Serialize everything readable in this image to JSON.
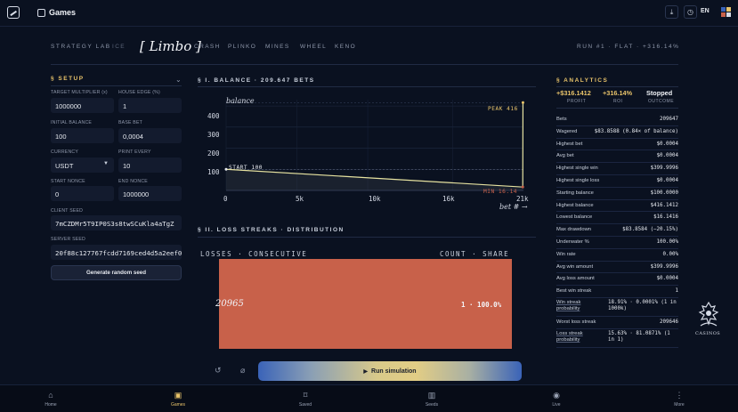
{
  "app": {
    "title": "Games",
    "language": "EN"
  },
  "strategy": {
    "label": "STRATEGY LAB",
    "tabs": [
      "ICE",
      "CRASH",
      "PLINKO",
      "MINES",
      "WHEEL",
      "KENO"
    ],
    "active_game": "[ Limbo ]",
    "run_info": "RUN #1 · FLAT · +316.14%"
  },
  "setup": {
    "title": "§ SETUP",
    "target_multiplier": {
      "label": "TARGET MULTIPLIER (x)",
      "value": "1000000"
    },
    "house_edge": {
      "label": "HOUSE EDGE (%)",
      "value": "1"
    },
    "initial_balance": {
      "label": "INITIAL BALANCE",
      "value": "100"
    },
    "base_bet": {
      "label": "BASE BET",
      "value": "0,0004"
    },
    "currency": {
      "label": "CURRENCY",
      "value": "USDT"
    },
    "print_every": {
      "label": "PRINT EVERY",
      "value": "10"
    },
    "start_nonce": {
      "label": "START NONCE",
      "value": "0"
    },
    "end_nonce": {
      "label": "END NONCE",
      "value": "1000000"
    },
    "client_seed": {
      "label": "CLIENT SEED",
      "value": "7mCZDMr5T9IP0S3s8twSCuKla4aTgZ"
    },
    "server_seed": {
      "label": "SERVER SEED",
      "value": "20f88c127767fcdd7169ced4d5a2eef0b"
    },
    "generate_label": "Generate random seed"
  },
  "balance_chart": {
    "section_title": "§ I. BALANCE · 209.647 BETS",
    "annotations": {
      "start": "START 100",
      "peak": "PEAK 416",
      "min": "MIN 16.14"
    }
  },
  "chart_data": {
    "type": "line",
    "title": "",
    "xlabel": "bet # →",
    "ylabel": "balance",
    "x_ticks": [
      "0",
      "5k",
      "10k",
      "16k",
      "21k"
    ],
    "y_ticks": [
      "100",
      "200",
      "300",
      "400"
    ],
    "xlim": [
      0,
      21000
    ],
    "ylim": [
      0,
      430
    ],
    "grid": true,
    "series": [
      {
        "x": [
          0,
          20950,
          20965
        ],
        "y": [
          100,
          16.14,
          416.14
        ]
      }
    ]
  },
  "distribution": {
    "section_title": "§ II. LOSS STREAKS · DISTRIBUTION",
    "col_left": "LOSSES · CONSECUTIVE",
    "col_right": "COUNT · SHARE",
    "rows": [
      {
        "key": "20965",
        "value": "1 · 100.0%",
        "share": 1.0
      }
    ]
  },
  "controls": {
    "run_label": "Run simulation",
    "reset_icon": "↺",
    "link_icon": "⌀"
  },
  "analytics": {
    "title": "§ ANALYTICS",
    "kpis": [
      {
        "value": "+$316.1412",
        "label": "PROFIT",
        "color": "#e8c36a"
      },
      {
        "value": "+316.14%",
        "label": "ROI",
        "color": "#e8c36a"
      },
      {
        "value": "Stopped",
        "label": "OUTCOME",
        "color": "#f0f3f8"
      }
    ],
    "rows": [
      {
        "k": "Bets",
        "v": "209647"
      },
      {
        "k": "Wagered",
        "v": "$83.8588 (0.84× of balance)"
      },
      {
        "k": "Highest bet",
        "v": "$0.0004"
      },
      {
        "k": "Avg bet",
        "v": "$0.0004"
      },
      {
        "k": "Highest single win",
        "v": "$399.9996"
      },
      {
        "k": "Highest single loss",
        "v": "$0.0004"
      },
      {
        "k": "Starting balance",
        "v": "$100.0000"
      },
      {
        "k": "Highest balance",
        "v": "$416.1412"
      },
      {
        "k": "Lowest balance",
        "v": "$16.1416"
      },
      {
        "k": "Max drawdown",
        "v": "$83.8584 (−20.15%)"
      },
      {
        "k": "Underwater %",
        "v": "100.00%"
      },
      {
        "k": "Win rate",
        "v": "0.00%"
      },
      {
        "k": "Avg win amount",
        "v": "$399.9996"
      },
      {
        "k": "Avg loss amount",
        "v": "$0.0004"
      },
      {
        "k": "Best win streak",
        "v": "1"
      }
    ],
    "tall_rows": [
      {
        "k": "Win streak probability",
        "v": "18.91% · 0.0001% (1 in 1000k)"
      },
      {
        "k": "Worst loss streak",
        "v": "209646"
      },
      {
        "k": "Loss streak probability",
        "v": "15.63% · 81.0871% (1 in 1)"
      }
    ],
    "logo_text": "CASINOS"
  },
  "bottom_nav": [
    {
      "label": "Home",
      "icon": "home-icon"
    },
    {
      "label": "Games",
      "icon": "games-icon"
    },
    {
      "label": "Saved",
      "icon": "bookmark-icon"
    },
    {
      "label": "Seeds",
      "icon": "chart-icon"
    },
    {
      "label": "Live",
      "icon": "live-icon"
    },
    {
      "label": "More",
      "icon": "more-icon"
    }
  ]
}
